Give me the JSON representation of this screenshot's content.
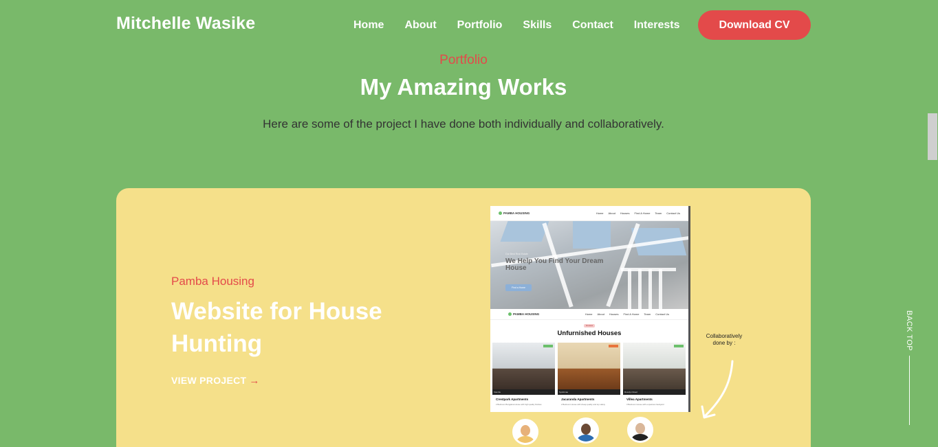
{
  "brand": "Mitchelle Wasike",
  "nav": {
    "items": [
      "Home",
      "About",
      "Portfolio",
      "Skills",
      "Contact",
      "Interests"
    ],
    "cta": "Download CV"
  },
  "portfolio": {
    "eyebrow": "Portfolio",
    "title": "My Amazing Works",
    "description": "Here are some of the project I have done both individually and collaboratively."
  },
  "project": {
    "eyebrow": "Pamba Housing",
    "title": "Website for House Hunting",
    "link_label": "VIEW PROJECT",
    "link_arrow": "→",
    "annotation": "Collaboratively done by :",
    "colors": {
      "card_bg": "#f5e08a",
      "accent": "#e34a4a"
    }
  },
  "mockup": {
    "logo": "PAMBA HOUSING",
    "nav": [
      "Home",
      "About",
      "Houses",
      "Find A Home",
      "Team",
      "Contact Us"
    ],
    "hero_small": "Our Best Real Estate",
    "hero_heading": "We Help You Find Your Dream House",
    "hero_button": "Find a Home",
    "tag": "Houses",
    "section_heading": "Unfurnished Houses",
    "cards": [
      {
        "title": "Crestpark Apartments",
        "location": "Kiambu",
        "text": "2 Bedroom Bungalow House with high quality finishes"
      },
      {
        "title": "Jacaranda Apartments",
        "location": "Syokimau",
        "text": "2 Bedroom House with cheap quality and top safety"
      },
      {
        "title": "Villea Apartments",
        "location": "Rosslyn Road",
        "text": "3 Bedroom House with a spacious backyard"
      }
    ]
  },
  "back_top": "BACK TOP",
  "colors": {
    "page_bg": "#79b96a",
    "cta_bg": "#e34a4a",
    "text_light": "#ffffff"
  },
  "icons": [
    "arrow-right-icon",
    "curved-arrow-icon",
    "avatar-icon"
  ]
}
